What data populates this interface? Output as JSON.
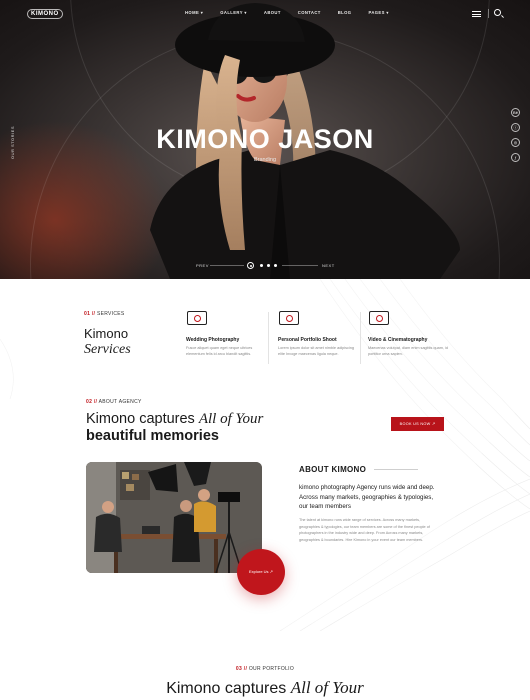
{
  "nav": {
    "logo": "KIMONO",
    "items": [
      "HOME ▾",
      "GALLERY ▾",
      "ABOUT",
      "CONTACT",
      "BLOG",
      "PAGES ▾"
    ]
  },
  "hero": {
    "side_text": "OUR STORIES",
    "title": "KIMONO JASON",
    "subtitle": "Branding",
    "prev": "PREV",
    "next": "NEXT",
    "socials": [
      "Bē",
      "ⓘ",
      "◎",
      "ƒ"
    ]
  },
  "services": {
    "label_num": "01 //",
    "label": "SERVICES",
    "title_line1": "Kimono",
    "title_line2": "Services",
    "items": [
      {
        "name": "Wedding Photography",
        "desc": "Fusce aliquet quam eget neque ultrices elementum felis id arcu blandit sagittis."
      },
      {
        "name": "Personal Portfolio Shoot",
        "desc": "Lorem ipsum dolor sit amet nimble adipiscing elite Invoge maecenas ligula neque."
      },
      {
        "name": "Video & Cinematography",
        "desc": "Maecenas volutpat, diam enim sagittis quam, id porttitor urna sapien."
      }
    ]
  },
  "about": {
    "label_num": "02 //",
    "label": "ABOUT AGENCY",
    "title_plain": "Kimono captures ",
    "title_italic": "All of Your",
    "title_line2": "beautiful memories",
    "book_button": "BOOK US NOW ↗",
    "heading": "ABOUT KIMONO",
    "lead": "kimono photography Agency runs wide and deep. Across many markets, geographies & typologies, our team members",
    "body": "The talent at kimono runs wide range of services. Across many markets, geographies & typologies, our team members are some of the finest people of photographers in the industry wide and deep. From Across many markets, geographies & boundaries. Hire Kimono in your event our team members.",
    "explore_button": "Explore Us ↗"
  },
  "portfolio": {
    "label_num": "03 //",
    "label": "OUR PORTFOLIO",
    "title_plain": "Kimono captures ",
    "title_italic": "All of Your"
  }
}
